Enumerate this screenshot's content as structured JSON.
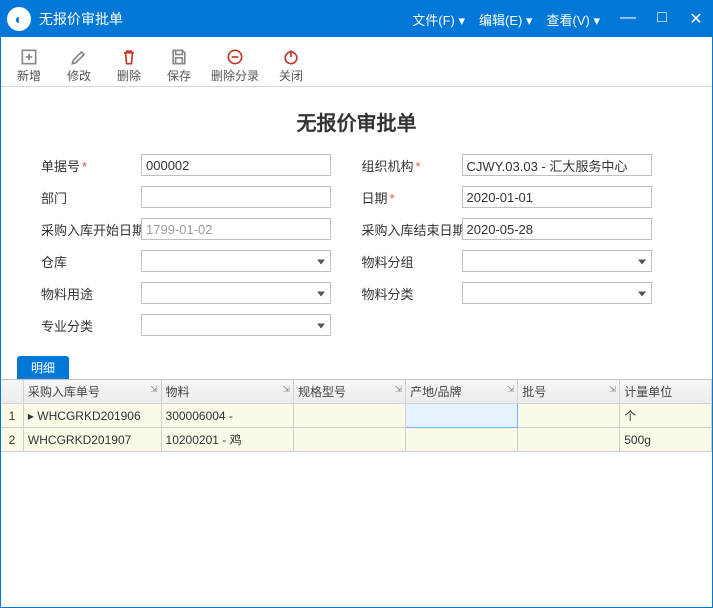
{
  "window": {
    "title": "无报价审批单"
  },
  "menus": {
    "file": "文件(F)",
    "edit": "编辑(E)",
    "view": "查看(V)"
  },
  "toolbar": {
    "new": "新增",
    "modify": "修改",
    "delete": "删除",
    "save": "保存",
    "delete_entry": "删除分录",
    "close": "关闭"
  },
  "heading": "无报价审批单",
  "form": {
    "doc_no": {
      "label": "单据号",
      "value": "000002"
    },
    "org": {
      "label": "组织机构",
      "value": "CJWY.03.03  - 汇大服务中心"
    },
    "dept": {
      "label": "部门",
      "value": ""
    },
    "date": {
      "label": "日期",
      "value": "2020-01-01"
    },
    "purchase_start": {
      "label": "采购入库开始日期",
      "value": "1799-01-02"
    },
    "purchase_end": {
      "label": "采购入库结束日期",
      "value": "2020-05-28"
    },
    "warehouse": {
      "label": "仓库",
      "value": ""
    },
    "material_group": {
      "label": "物料分组",
      "value": ""
    },
    "material_use": {
      "label": "物料用途",
      "value": ""
    },
    "material_cat": {
      "label": "物料分类",
      "value": ""
    },
    "spec_cat": {
      "label": "专业分类",
      "value": ""
    }
  },
  "tab": {
    "detail": "明细"
  },
  "grid": {
    "columns": {
      "purchase_doc": "采购入库单号",
      "material": "物料",
      "spec": "规格型号",
      "origin": "产地/品牌",
      "batch": "批号",
      "unit": "计量单位"
    },
    "rows": [
      {
        "purchase_doc": "WHCGRKD201906",
        "material": "300006004 - ",
        "spec": "",
        "origin": "",
        "batch": "",
        "unit": "个"
      },
      {
        "purchase_doc": "WHCGRKD201907",
        "material": "10200201 - 鸡",
        "spec": "",
        "origin": "",
        "batch": "",
        "unit": "500g"
      }
    ]
  }
}
